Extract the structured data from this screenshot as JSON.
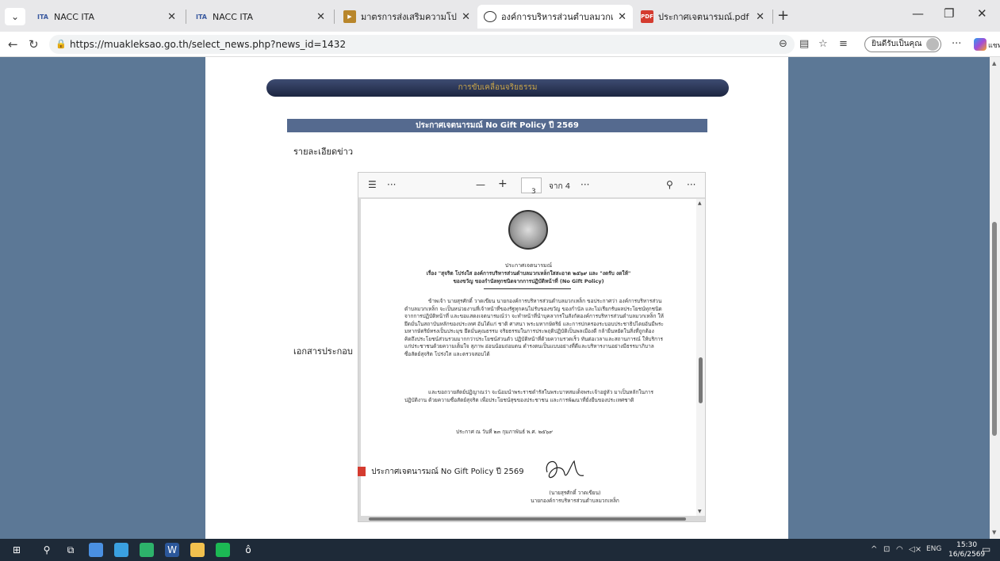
{
  "tabs": [
    {
      "title": "NACC ITA",
      "icon": "ita-icon",
      "active": false
    },
    {
      "title": "NACC ITA",
      "icon": "ita-icon",
      "active": false
    },
    {
      "title": "มาตรการส่งเสริมความโปร่งใสและป้องกัน",
      "icon": "youtube-icon",
      "active": false
    },
    {
      "title": "องค์การบริหารส่วนตำบลมวกเหล็ก อำเภ",
      "icon": "globe-icon",
      "active": true
    },
    {
      "title": "ประกาศเจตนารมณ์.pdf",
      "icon": "pdf-icon",
      "active": false
    }
  ],
  "address": {
    "url": "https://muakleksao.go.th/select_news.php?news_id=1432"
  },
  "profile": {
    "signin_label": "ยินดีรับเป็นคุณ"
  },
  "copilot": {
    "label": "แชท"
  },
  "page": {
    "section_title": "การขับเคลื่อนจริยธรรม",
    "news_title": "ประกาศเจตนารมณ์ No Gift Policy ปี 2569",
    "details_label": "รายละเอียดข่าว",
    "attachments_label": "เอกสารประกอบ",
    "attachment_name": "ประกาศเจตนารมณ์ No Gift Policy ปี 2569"
  },
  "pdf": {
    "page_current": "3",
    "page_total_label": "จาก 4",
    "heading": "ประกาศเจตนารมณ์",
    "subject_line1": "เรื่อง \"สุจริต โปร่งใส องค์การบริหารส่วนตำบลมวกเหล็กใสสะอาด ๒๕๖๙ และ \"งดรับ งดให้\"",
    "subject_line2": "ของขวัญ ของกำนัลทุกชนิดจากการปฏิบัติหน้าที่ (No Gift Policy)",
    "body1": "ข้าพเจ้า นายสุรศักดิ์ วาดเขียน นายกองค์การบริหารส่วนตำบลมวกเหล็ก ขอประกาศว่า องค์การบริหารส่วนตำบลมวกเหล็ก จะเป็นหน่วยงานที่เจ้าหน้าที่ของรัฐทุกคนไม่รับของขวัญ ของกำนัล และไม่เรียกรับผลประโยชน์ทุกชนิดจากการปฏิบัติหน้าที่ และขอแสดงเจตนารมณ์ว่า จะทำหน้าที่นำบุคลากรในสังกัดองค์การบริหารส่วนตำบลมวกเหล็ก ให้ยึดมั่นในสถาบันหลักของประเทศ อันได้แก่ ชาติ ศาสนา พระมหากษัตริย์ และการปกครองระบอบประชาธิปไตยอันมีพระมหากษัตริย์ทรงเป็นประมุข ยึดมั่นคุณธรรม จริยธรรมในการประพฤติปฏิบัติเป็นพลเมืองดี กล้ายืนหยัดในสิ่งที่ถูกต้อง คิดถึงประโยชน์ส่วนรวมมากกว่าประโยชน์ส่วนตัว ปฏิบัติหน้าที่ด้วยความรวดเร็ว ทันต่อเวลาและสถานการณ์ ให้บริการแก่ประชาชนด้วยความเต็มใจ สุภาพ อ่อนน้อมถ่อมตน ดำรงตนเป็นแบบอย่างที่ดีและบริหารงานอย่างมีธรรมาภิบาล ซื่อสัตย์สุจริต โปร่งใส และตรวจสอบได้",
    "body2": "และขอถวายสัตย์ปฏิญาณว่า จะน้อมนำพระราชดำรัสในพระบาทสมเด็จพระเจ้าอยู่หัว มาเป็นหลักในการปฏิบัติงาน ด้วยความซื่อสัตย์สุจริต เพื่อประโยชน์สุขของประชาชน และการพัฒนาที่ยั่งยืนของประเทศชาติ",
    "date_line": "ประกาศ ณ วันที่ ๒๓ กุมภาพันธ์ พ.ศ. ๒๕๖๙",
    "signer_name": "(นายสุรศักดิ์ วาดเขียน)",
    "signer_title": "นายกองค์การบริหารส่วนตำบลมวกเหล็ก"
  },
  "taskbar": {
    "lang": "ENG",
    "time": "15:30",
    "date": "16/6/2569"
  },
  "colors": {
    "page_bg": "#5c7896",
    "pill_gold": "#c8a44a",
    "title_bar": "#556a8f"
  }
}
